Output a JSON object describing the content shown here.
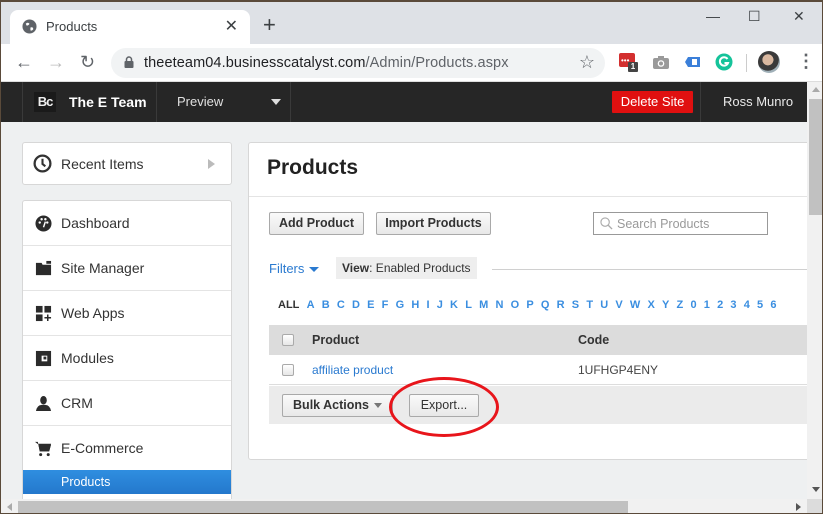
{
  "browser": {
    "tab_title": "Products",
    "url_host": "theeteam04.businesscatalyst.com",
    "url_path": "/Admin/Products.aspx",
    "extension_badge": "1"
  },
  "topbar": {
    "logo": "Bc",
    "site_name": "The E Team",
    "preview_label": "Preview",
    "delete_site_label": "Delete Site",
    "user_name": "Ross Munro"
  },
  "sidebar": {
    "recent_items_label": "Recent Items",
    "items": [
      {
        "label": "Dashboard",
        "icon": "dashboard-icon"
      },
      {
        "label": "Site Manager",
        "icon": "folder-icon"
      },
      {
        "label": "Web Apps",
        "icon": "web-apps-icon"
      },
      {
        "label": "Modules",
        "icon": "modules-icon"
      },
      {
        "label": "CRM",
        "icon": "user-icon"
      },
      {
        "label": "E-Commerce",
        "icon": "cart-icon"
      }
    ],
    "active_subitem": "Products"
  },
  "main": {
    "title": "Products",
    "add_product_label": "Add Product",
    "import_products_label": "Import Products",
    "search_placeholder": "Search Products",
    "filters_label": "Filters",
    "view_label": "View",
    "view_value": ": Enabled Products",
    "alpha_filter": [
      "ALL",
      "A",
      "B",
      "C",
      "D",
      "E",
      "F",
      "G",
      "H",
      "I",
      "J",
      "K",
      "L",
      "M",
      "N",
      "O",
      "P",
      "Q",
      "R",
      "S",
      "T",
      "U",
      "V",
      "W",
      "X",
      "Y",
      "Z",
      "0",
      "1",
      "2",
      "3",
      "4",
      "5",
      "6"
    ],
    "alpha_active": "ALL",
    "table": {
      "columns": [
        "Product",
        "Code"
      ],
      "rows": [
        {
          "product": "affiliate product",
          "code": "1UFHGP4ENY"
        }
      ]
    },
    "bulk_actions_label": "Bulk Actions",
    "export_label": "Export..."
  },
  "colors": {
    "accent_blue": "#2a7ad0",
    "delete_red": "#e01010",
    "annotation_red": "#e8151b",
    "topbar_bg": "#262626"
  }
}
